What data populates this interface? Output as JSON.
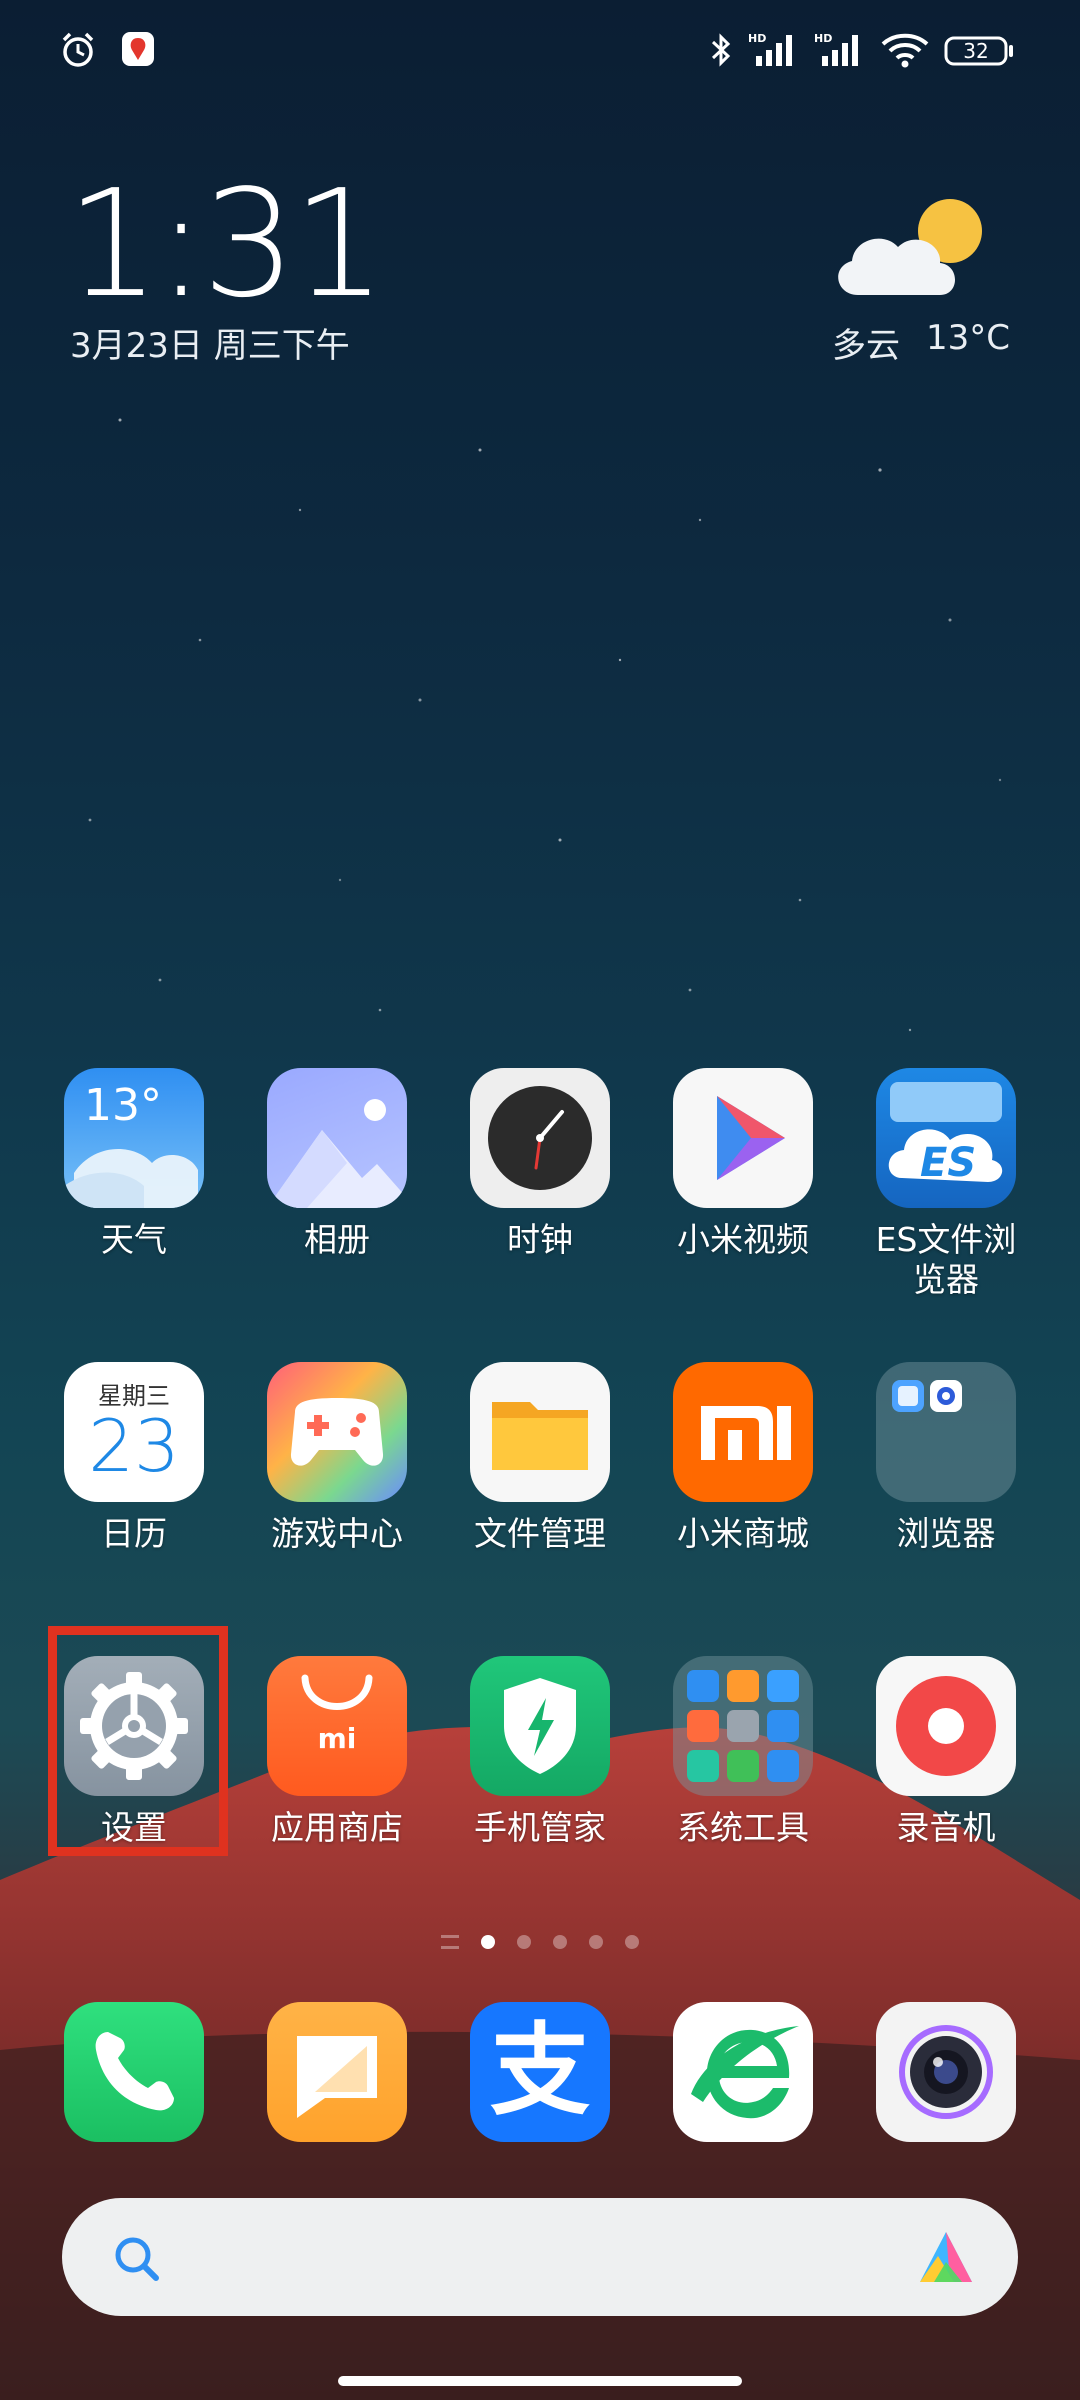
{
  "status_bar": {
    "left_icons": [
      "alarm-icon",
      "notification-app-icon"
    ],
    "right_icons": [
      "bluetooth-icon",
      "signal-hd-1-icon",
      "signal-hd-2-icon",
      "wifi-icon",
      "battery-icon"
    ],
    "hd_label": "HD",
    "battery": "32"
  },
  "clock": {
    "time": "1:31",
    "date": "3月23日 周三下午"
  },
  "weather": {
    "condition": "多云",
    "temperature": "13°C",
    "icon": "partly-cloudy-icon"
  },
  "apps": {
    "row1": [
      {
        "label": "天气",
        "icon": "weather-app-icon",
        "badge": "13°"
      },
      {
        "label": "相册",
        "icon": "gallery-app-icon"
      },
      {
        "label": "时钟",
        "icon": "clock-app-icon"
      },
      {
        "label": "小米视频",
        "icon": "mi-video-app-icon"
      },
      {
        "label": "ES文件浏览器",
        "icon": "es-file-explorer-icon",
        "label_line1": "ES文件浏",
        "label_line2": "览器",
        "icon_text": "ES"
      }
    ],
    "row2": [
      {
        "label": "日历",
        "icon": "calendar-app-icon",
        "weekday": "星期三",
        "day": "23"
      },
      {
        "label": "游戏中心",
        "icon": "game-center-app-icon"
      },
      {
        "label": "文件管理",
        "icon": "file-manager-app-icon"
      },
      {
        "label": "小米商城",
        "icon": "mi-store-app-icon",
        "icon_text": "mi"
      },
      {
        "label": "浏览器",
        "icon": "browser-folder-icon"
      }
    ],
    "row3": [
      {
        "label": "设置",
        "icon": "settings-app-icon"
      },
      {
        "label": "应用商店",
        "icon": "app-store-app-icon",
        "icon_text": "mi"
      },
      {
        "label": "手机管家",
        "icon": "security-app-icon"
      },
      {
        "label": "系统工具",
        "icon": "system-tools-folder-icon"
      },
      {
        "label": "录音机",
        "icon": "recorder-app-icon"
      }
    ]
  },
  "dock": [
    {
      "icon": "phone-app-icon"
    },
    {
      "icon": "messages-app-icon"
    },
    {
      "icon": "alipay-app-icon",
      "icon_text": "支"
    },
    {
      "icon": "ie-browser-app-icon"
    },
    {
      "icon": "camera-app-icon"
    }
  ],
  "page_indicator": {
    "pages": 5,
    "active": 0
  },
  "search": {
    "icon": "search-icon",
    "assistant_icon": "assistant-icon"
  },
  "colors": {
    "highlight": "#e0321f"
  }
}
